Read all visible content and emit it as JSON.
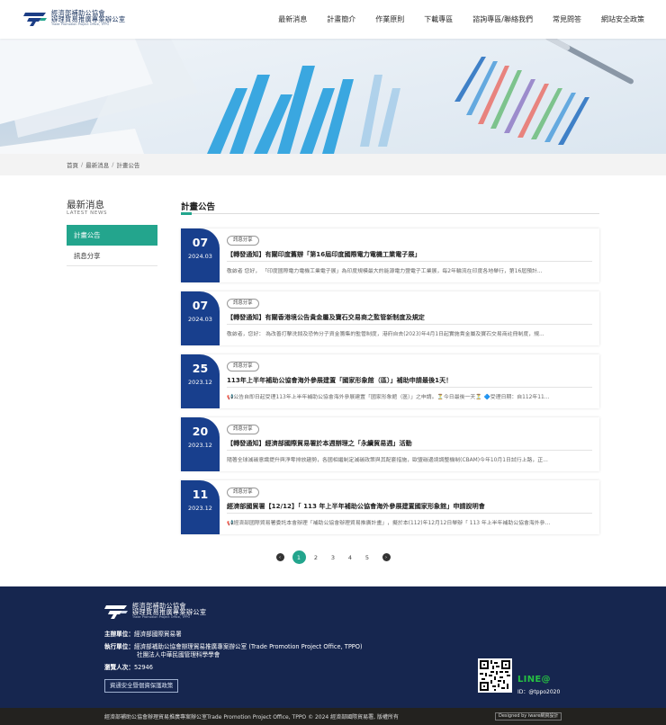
{
  "header": {
    "logo_line1": "經濟部補助公協會",
    "logo_line2": "辦理貿易推廣專案辦公室",
    "logo_line3": "Trade Promotion Project Office, TPPO",
    "nav": [
      "最新消息",
      "計畫簡介",
      "作業原則",
      "下載專區",
      "諮詢專區/聯絡我們",
      "常見問答",
      "網站安全政策"
    ]
  },
  "breadcrumb": [
    "首頁",
    "最新消息",
    "計畫公告"
  ],
  "sidebar": {
    "title": "最新消息",
    "subtitle": "LATEST NEWS",
    "items": [
      {
        "label": "計畫公告",
        "active": true
      },
      {
        "label": "訊息分享",
        "active": false
      }
    ]
  },
  "main": {
    "title": "計畫公告",
    "cards": [
      {
        "day": "07",
        "ym": "2024.03",
        "tag": "訊息分享",
        "title": "【轉發通知】有關印度舊辦「第16屆印度國際電力電機工業電子展」",
        "excerpt": "敬啟者 您好， 「印度國際電力電機工業電子展」為印度規模最大的能源電力暨電子工業展，每2年輪流在印度各地舉行，第16屆預計..."
      },
      {
        "day": "07",
        "ym": "2024.03",
        "tag": "訊息分享",
        "title": "【轉發通知】有關香港境公告貴金屬及寶石交易商之監管新制度及規定",
        "excerpt": "敬啟者，您好： 為改善打擊洗錢及恐怖分子資金籌集的監管制度，港府自去(2023)年4月1日起實施貴金屬及寶石交易商註冊制度，規..."
      },
      {
        "day": "25",
        "ym": "2023.12",
        "tag": "訊息分享",
        "title": "113年上半年補助公協會海外參展建置「國家形象館（區）」補助申請最後1天！",
        "excerpt": "📢公告自即日起受理113年上半年補助公協會海外參展建置「國家形象館（區）」之申請。⏳今日最後一天⏳ 🔷受理日期：自112年11..."
      },
      {
        "day": "20",
        "ym": "2023.12",
        "tag": "訊息分享",
        "title": "【轉發通知】經濟部國際貿易署於本週辦理之「永續貿易週」活動",
        "excerpt": "隨著全球減碳意識提升與淨零排放趨勢，各國相繼制定減碳政策與其配套措施，歐盟碳邊境調整機制(CBAM)今年10月1日試行上路，正..."
      },
      {
        "day": "11",
        "ym": "2023.12",
        "tag": "訊息分享",
        "title": "經濟部國貿署【12/12】「 113 年上半年補助公協會海外參展建置國家形象館」申請說明會",
        "excerpt": "📢經濟部國際貿易署委託本會辦理「補助公協會辦理貿易推廣計畫」，擬於本(112)年12月12日舉辦「 113 年上半年補助公協會海外參..."
      }
    ]
  },
  "pagination": {
    "prev": "‹",
    "next": "›",
    "pages": [
      "1",
      "2",
      "3",
      "4",
      "5"
    ],
    "active": "1"
  },
  "footer": {
    "logo_line1": "經濟部補助公協會",
    "logo_line2": "辦理貿易推廣專案辦公室",
    "logo_line3": "Trade Promotion Project Office, TPPO",
    "host_label": "主辦單位：",
    "host_value": "經濟部國際貿易署",
    "exec_label": "執行單位：",
    "exec_value1": "經濟部補助公協會辦理貿易推廣專案辦公室 (Trade Promotion Project Office, TPPO)",
    "exec_value2": "社團法人中華民國管理科學學會",
    "visitors_label": "瀏覽人次：",
    "visitors_value": "52946",
    "security_btn": "資通安全暨個資保護政策",
    "line_label": "LINE@",
    "line_id": "ID：@tppo2020",
    "copyright": "經濟部補助公協會辦理貿易推廣專案辦公室Trade Promotion Project Office, TPPO © 2024 經濟部國際貿易署, 版權所有",
    "designer": "Designed by iware網資設計"
  },
  "colors": {
    "accent": "#23a58d",
    "navy": "#183f8d",
    "footer": "#16264f"
  }
}
